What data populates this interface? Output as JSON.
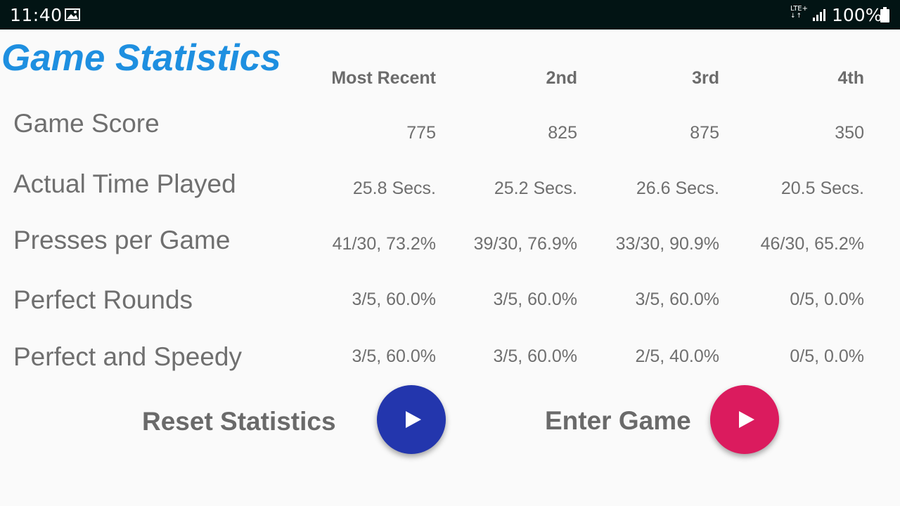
{
  "status_bar": {
    "time": "11:40",
    "network": "LTE+",
    "battery_percent": "100%",
    "icons": [
      "image-icon",
      "lte-icon",
      "signal-icon",
      "battery-icon"
    ]
  },
  "title": "Game Statistics",
  "columns": [
    "Most Recent",
    "2nd",
    "3rd",
    "4th"
  ],
  "rows": [
    {
      "label": "Game Score",
      "values": [
        "775",
        "825",
        "875",
        "350"
      ]
    },
    {
      "label": "Actual Time Played",
      "values": [
        "25.8 Secs.",
        "25.2 Secs.",
        "26.6 Secs.",
        "20.5 Secs."
      ]
    },
    {
      "label": "Presses per Game",
      "values": [
        "41/30, 73.2%",
        "39/30, 76.9%",
        "33/30, 90.9%",
        "46/30, 65.2%"
      ]
    },
    {
      "label": "Perfect Rounds",
      "values": [
        "3/5, 60.0%",
        "3/5, 60.0%",
        "3/5, 60.0%",
        "0/5, 0.0%"
      ]
    },
    {
      "label": "Perfect and Speedy",
      "values": [
        "3/5, 60.0%",
        "3/5, 60.0%",
        "2/5, 40.0%",
        "0/5, 0.0%"
      ]
    }
  ],
  "actions": {
    "reset_label": "Reset Statistics",
    "enter_label": "Enter Game",
    "reset_color": "#2336ad",
    "enter_color": "#db1b5e"
  },
  "colors": {
    "title": "#1e8fe0",
    "status_bar": "#021414",
    "background": "#fafafa"
  }
}
